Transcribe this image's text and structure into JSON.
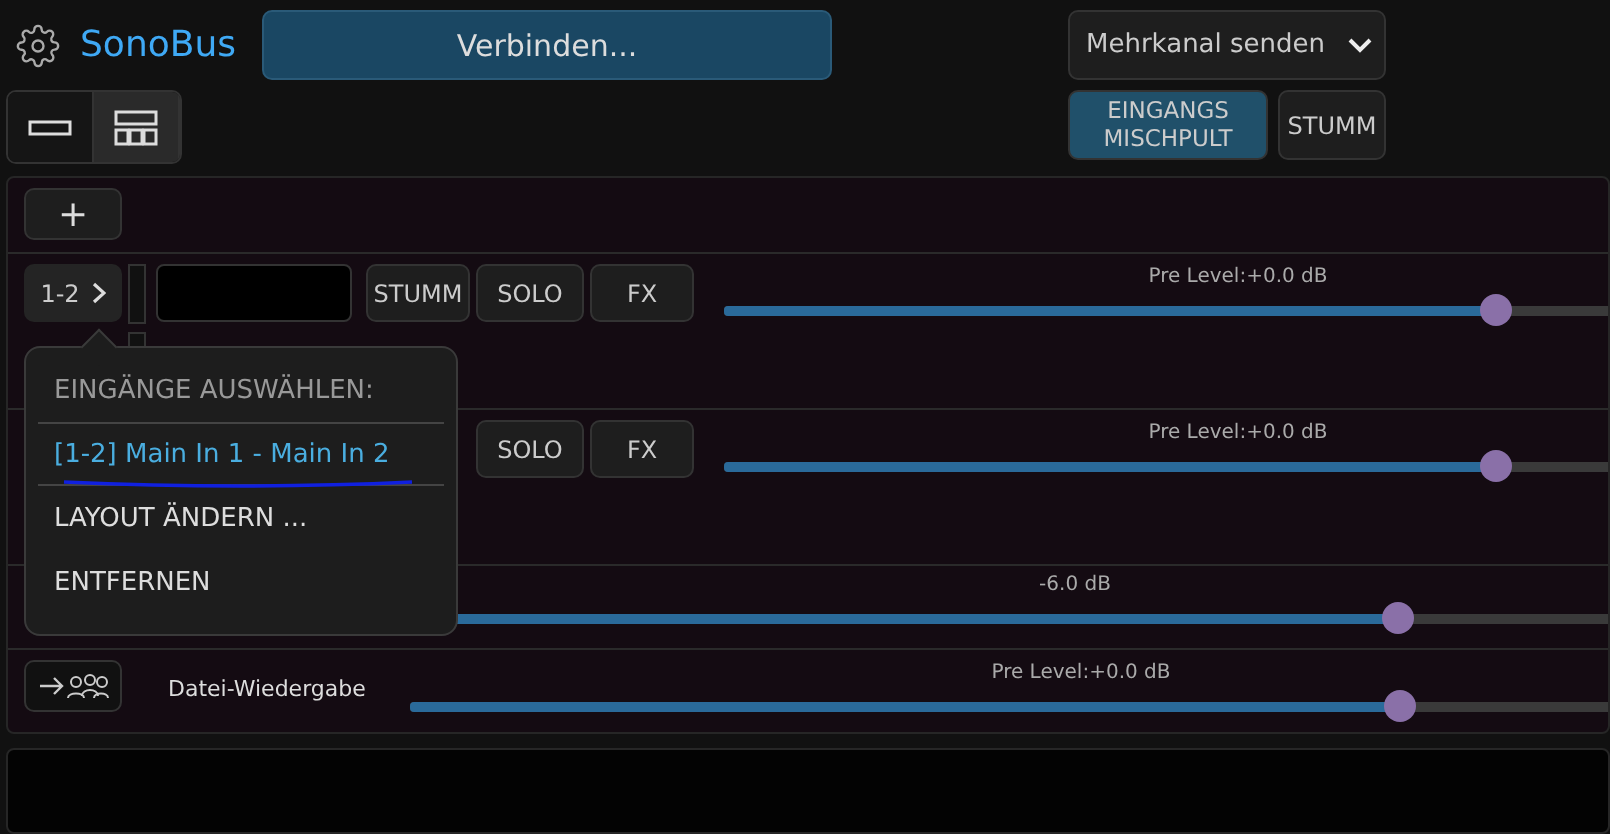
{
  "header": {
    "app_name": "SonoBus",
    "connect_button": "Verbinden...",
    "layout_toggle": [
      {
        "kind": "single",
        "selected": false
      },
      {
        "kind": "mixer",
        "selected": true
      }
    ],
    "send_mode": "Mehrkanal senden",
    "input_mixer_button": {
      "label": "EINGANGS\nMISCHPULT",
      "selected": true
    },
    "mute_button": "STUMM"
  },
  "inputs": {
    "add_button": "+",
    "channels": [
      {
        "input": "1-2",
        "buttons": [
          "STUMM",
          "SOLO",
          "FX"
        ],
        "slider_label": "Pre Level:+0.0 dB",
        "level": 0.85
      },
      {
        "buttons": [
          "SOLO",
          "FX"
        ],
        "slider_label": "Pre Level:+0.0 dB",
        "level": 0.85
      }
    ],
    "monitor": {
      "slider_label": "-6.0 dB",
      "level": 0.81
    },
    "file_playback": {
      "label": "Datei-Wiedergabe",
      "slider_label": "Pre Level:+0.0 dB",
      "level": 0.81
    }
  },
  "popup": {
    "title": "EINGÄNGE AUSWÄHLEN:",
    "items": [
      {
        "label": "[1-2] Main In 1 - Main In 2",
        "selected": true
      },
      {
        "label": "LAYOUT ÄNDERN ...",
        "selected": false
      },
      {
        "label": "ENTFERNEN",
        "selected": false
      }
    ]
  }
}
